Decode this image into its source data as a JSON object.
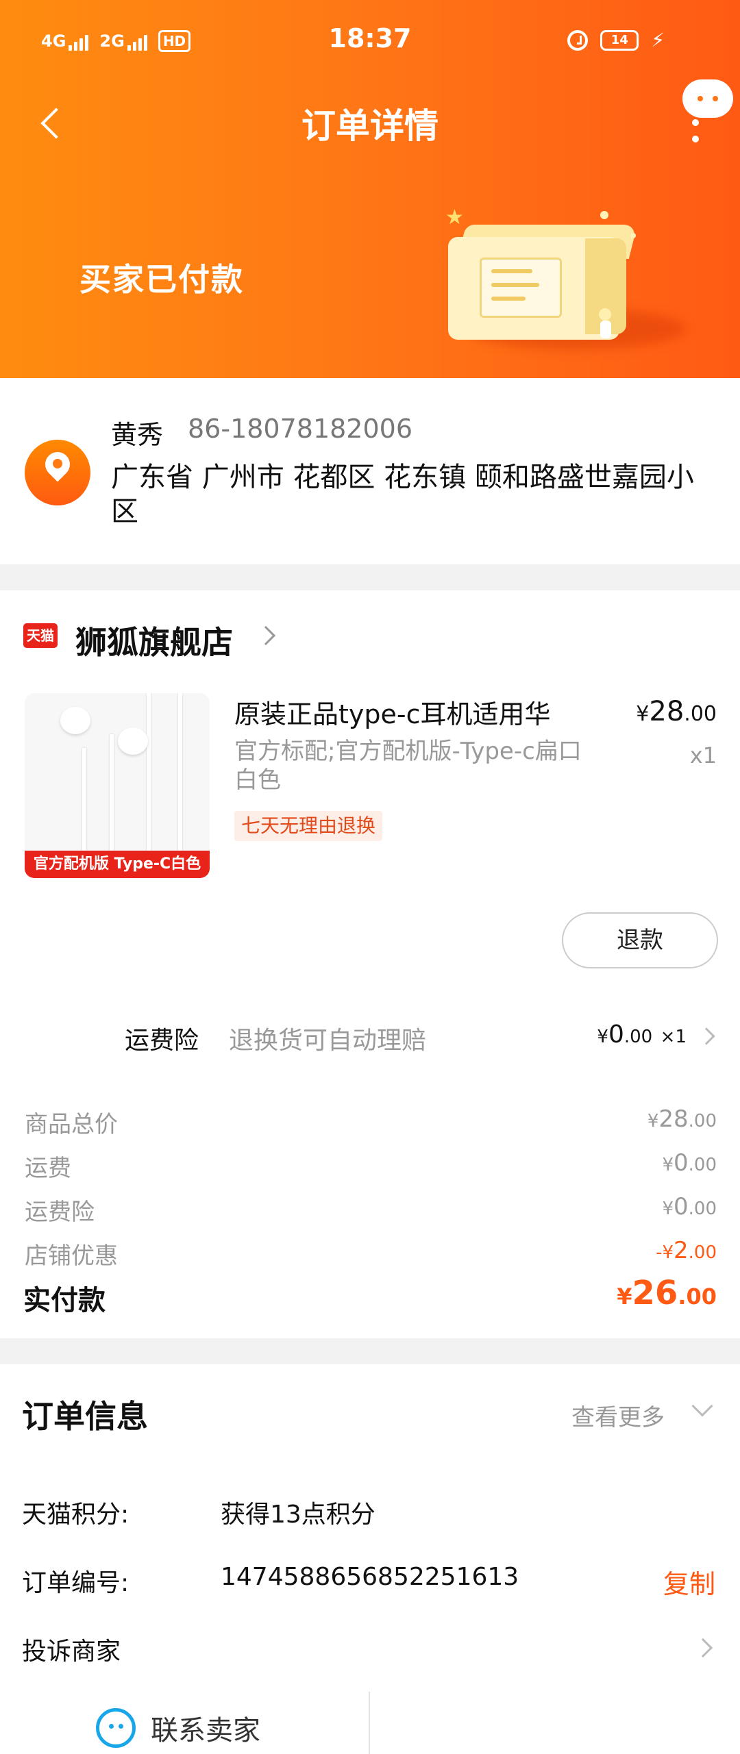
{
  "status_bar": {
    "network1": "4G",
    "network2": "2G",
    "hd_label": "HD",
    "time": "18:37",
    "battery": "14"
  },
  "navbar": {
    "title": "订单详情"
  },
  "order_status": {
    "text": "买家已付款"
  },
  "address": {
    "name": "黄秀",
    "phone": "86-18078182006",
    "full": "广东省 广州市 花都区 花东镇 颐和路盛世嘉园小区"
  },
  "store": {
    "platform_logo": "天猫",
    "name": "狮狐旗舰店"
  },
  "product": {
    "title": "原装正品type-c耳机适用华",
    "spec": "官方标配;官方配机版-Type-c扁口白色",
    "badge": "七天无理由退换",
    "image_tag": "官方配机版 Type-C白色",
    "price_currency": "¥",
    "price_int": "28",
    "price_dec": ".00",
    "qty": "x1",
    "refund_label": "退款"
  },
  "insurance": {
    "name": "运费险",
    "desc": "退换货可自动理赔",
    "price_currency": "¥",
    "price_int": "0",
    "price_dec": ".00",
    "qty": "×1"
  },
  "summary": {
    "rows": [
      {
        "label": "商品总价",
        "currency": "¥",
        "int": "28",
        "dec": ".00"
      },
      {
        "label": "运费",
        "currency": "¥",
        "int": "0",
        "dec": ".00"
      },
      {
        "label": "运费险",
        "currency": "¥",
        "int": "0",
        "dec": ".00"
      },
      {
        "label": "店铺优惠",
        "currency": "-¥",
        "int": "2",
        "dec": ".00"
      }
    ],
    "total_label": "实付款",
    "total_currency": "¥",
    "total_int": "26",
    "total_dec": ".00"
  },
  "order_info": {
    "title": "订单信息",
    "more_label": "查看更多",
    "points_key": "天猫积分:",
    "points_val": "获得13点积分",
    "order_no_key": "订单编号:",
    "order_no_val": "1474588656852251613",
    "copy_label": "复制",
    "complaint_label": "投诉商家"
  },
  "footer": {
    "contact_label": "联系卖家"
  },
  "colors": {
    "header_start": "#ff8c10",
    "header_end": "#ff5a14",
    "accent": "#ff5a14",
    "tmall_red": "#e8231a",
    "contact_blue": "#17a6e8"
  }
}
